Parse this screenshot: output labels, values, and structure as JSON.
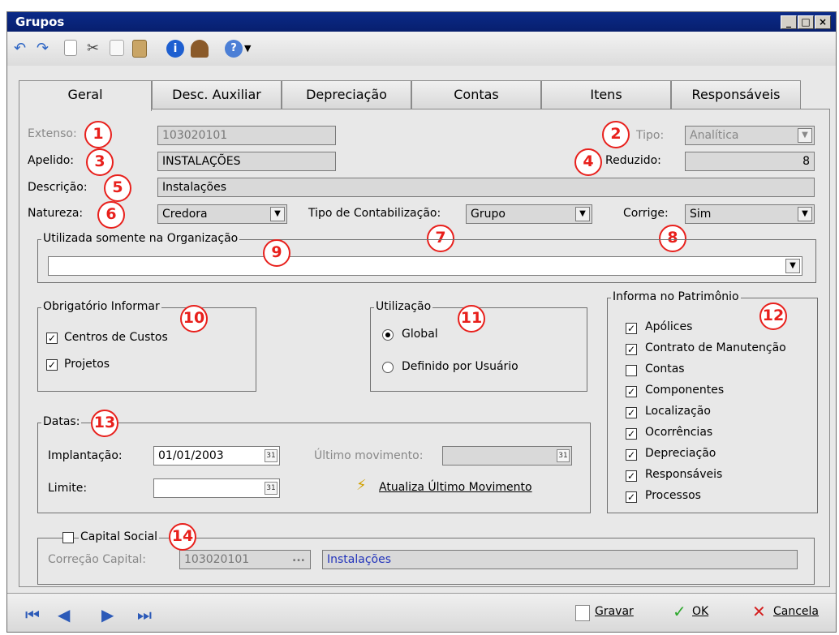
{
  "window": {
    "title": "Grupos"
  },
  "tabs": [
    "Geral",
    "Desc. Auxiliar",
    "Depreciação",
    "Contas",
    "Itens",
    "Responsáveis"
  ],
  "fields": {
    "extenso_label": "Extenso:",
    "extenso_value": "103020101",
    "tipo_label": "Tipo:",
    "tipo_value": "Analítica",
    "apelido_label": "Apelido:",
    "apelido_value": "INSTALAÇÕES",
    "reduzido_label": "Reduzido:",
    "reduzido_value": "8",
    "descricao_label": "Descrição:",
    "descricao_value": "Instalações",
    "natureza_label": "Natureza:",
    "natureza_value": "Credora",
    "tipo_contab_label": "Tipo de Contabilização:",
    "tipo_contab_value": "Grupo",
    "corrige_label": "Corrige:",
    "corrige_value": "Sim"
  },
  "org": {
    "title": "Utilizada somente na Organização",
    "value": ""
  },
  "obrigatorio": {
    "title": "Obrigatório Informar",
    "items": [
      {
        "label": "Centros de Custos",
        "checked": true
      },
      {
        "label": "Projetos",
        "checked": true
      }
    ]
  },
  "utilizacao": {
    "title": "Utilização",
    "options": [
      {
        "label": "Global",
        "selected": true
      },
      {
        "label": "Definido por Usuário",
        "selected": false
      }
    ]
  },
  "patrimonio": {
    "title": "Informa no Patrimônio",
    "items": [
      {
        "label": "Apólices",
        "checked": true
      },
      {
        "label": "Contrato de Manutenção",
        "checked": true
      },
      {
        "label": "Contas",
        "checked": false
      },
      {
        "label": "Componentes",
        "checked": true
      },
      {
        "label": "Localização",
        "checked": true
      },
      {
        "label": "Ocorrências",
        "checked": true
      },
      {
        "label": "Depreciação",
        "checked": true
      },
      {
        "label": "Responsáveis",
        "checked": true
      },
      {
        "label": "Processos",
        "checked": true
      }
    ]
  },
  "datas": {
    "title": "Datas:",
    "implantacao_label": "Implantação:",
    "implantacao_value": "01/01/2003",
    "limite_label": "Limite:",
    "limite_value": "",
    "ultimo_label": "Último movimento:",
    "ultimo_value": "",
    "atualiza_label": "Atualiza Último Movimento"
  },
  "capital": {
    "title": "Capital Social",
    "checked": false,
    "correcao_label": "Correção Capital:",
    "correcao_code": "103020101",
    "correcao_desc": "Instalações",
    "ellipsis": "..."
  },
  "callouts": [
    "1",
    "2",
    "3",
    "4",
    "5",
    "6",
    "7",
    "8",
    "9",
    "10",
    "11",
    "12",
    "13",
    "14"
  ],
  "bottom": {
    "gravar": "Gravar",
    "ok": "OK",
    "cancela": "Cancela"
  },
  "colors": {
    "titlebar": "#0a2a88",
    "callout": "#e8201c",
    "nav": "#2c5ab8"
  }
}
